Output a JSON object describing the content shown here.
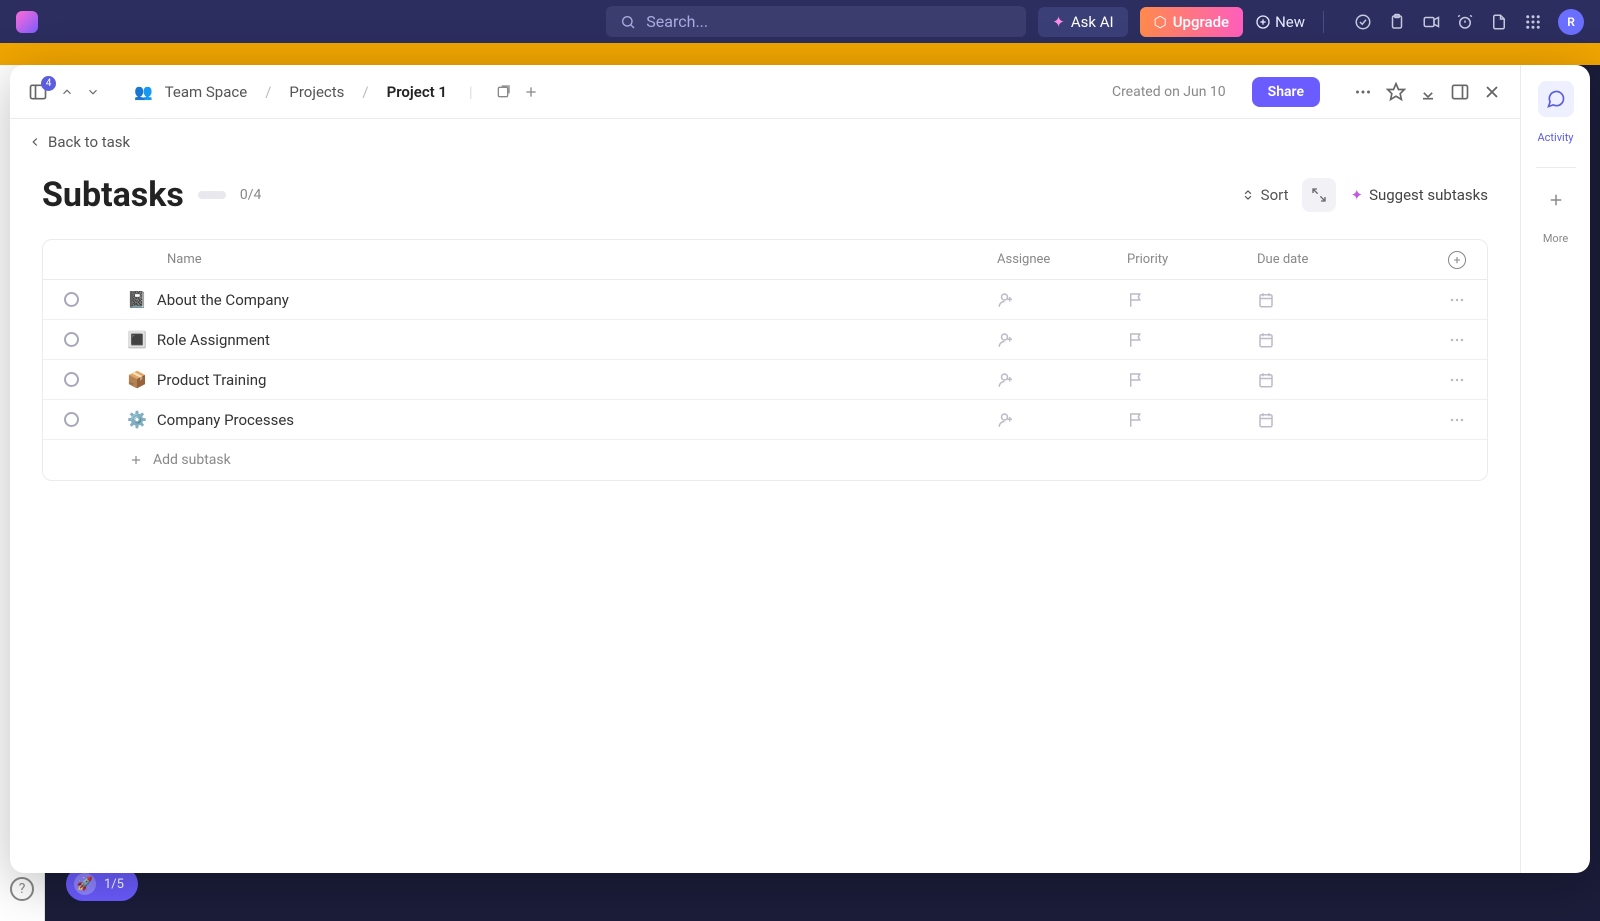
{
  "topbar": {
    "search_placeholder": "Search...",
    "ask_ai": "Ask AI",
    "upgrade": "Upgrade",
    "new": "New",
    "avatar_initial": "R"
  },
  "onboarding": {
    "progress": "1/5"
  },
  "modal": {
    "header": {
      "badge": "4",
      "crumb1": "Team Space",
      "crumb2": "Projects",
      "crumb3": "Project 1",
      "created": "Created on Jun 10",
      "share": "Share"
    },
    "back": "Back to task",
    "title": "Subtasks",
    "progress_text": "0/4",
    "sort": "Sort",
    "suggest": "Suggest subtasks",
    "side": {
      "activity": "Activity",
      "more": "More"
    },
    "columns": {
      "name": "Name",
      "assignee": "Assignee",
      "priority": "Priority",
      "due": "Due date"
    },
    "rows": [
      {
        "emoji": "📓",
        "name": "About the Company"
      },
      {
        "emoji": "🔳",
        "name": "Role Assignment"
      },
      {
        "emoji": "📦",
        "name": "Product Training"
      },
      {
        "emoji": "⚙️",
        "name": "Company Processes"
      }
    ],
    "add_subtask": "Add subtask"
  }
}
